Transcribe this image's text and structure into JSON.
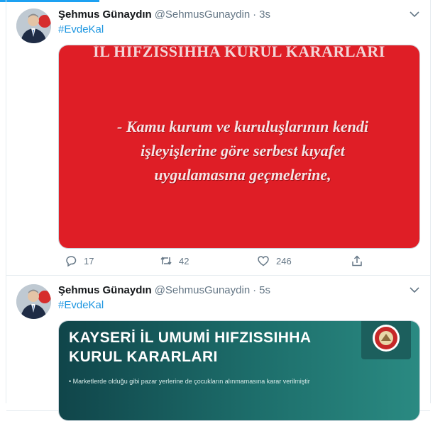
{
  "tweets": [
    {
      "name": "Şehmus Günaydın",
      "handle": "@SehmusGunaydin",
      "separator": "·",
      "time": "3s",
      "hashtag": "#EvdeKal",
      "media": {
        "title": "İL HIFZISSIHHA KURUL KARARLARI",
        "body_lines": [
          "- Kamu kurum ve kuruluşlarının kendi",
          "işleyişlerine göre serbest kıyafet",
          "uygulamasına geçmelerine,"
        ]
      },
      "stats": {
        "replies": "17",
        "retweets": "42",
        "likes": "246"
      }
    },
    {
      "name": "Şehmus Günaydın",
      "handle": "@SehmusGunaydin",
      "separator": "·",
      "time": "5s",
      "hashtag": "#EvdeKal",
      "media": {
        "title_lines": [
          "KAYSERİ İL UMUMİ HIFZISSIHHA",
          "KURUL KARARLARI"
        ],
        "bullet": "• Marketlerde olduğu gibi pazar yerlerine de çocukların alınmamasına karar verilmiştir"
      }
    }
  ],
  "icons": {
    "caret": "chevron-down-icon",
    "reply": "reply-icon",
    "retweet": "retweet-icon",
    "like": "heart-icon",
    "share": "share-icon"
  },
  "colors": {
    "accent": "#1da1f2",
    "hashtag": "#1b95e0",
    "muted": "#657786",
    "red_card": "#df1e26",
    "teal_card": "#1d6e6b"
  }
}
